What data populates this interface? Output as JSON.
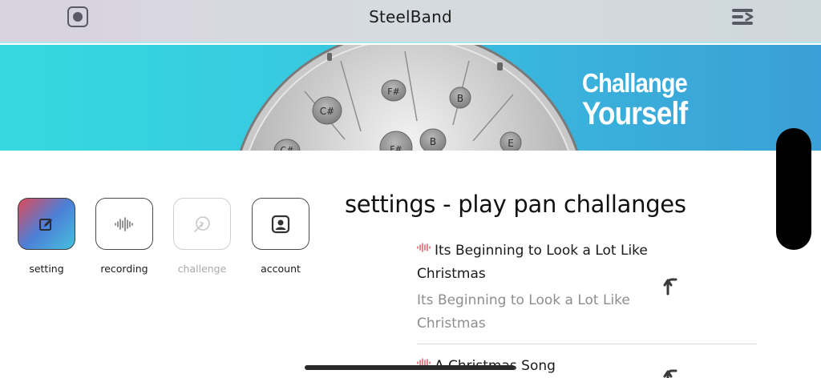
{
  "header": {
    "title": "SteelBand",
    "record_icon": "record-icon",
    "menu_icon": "menu-icon"
  },
  "banner": {
    "headline_line1": "Challange",
    "headline_line2": "Yourself",
    "drum_notes": [
      "F#",
      "C#",
      "B",
      "B",
      "E",
      "F#",
      "C#"
    ]
  },
  "nav": {
    "items": [
      {
        "label": "setting",
        "icon": "edit-icon",
        "state": "active"
      },
      {
        "label": "recording",
        "icon": "waveform-icon",
        "state": "normal"
      },
      {
        "label": "challenge",
        "icon": "target-icon",
        "state": "disabled"
      },
      {
        "label": "account",
        "icon": "person-icon",
        "state": "normal"
      }
    ]
  },
  "main": {
    "title": "settings - play pan challanges",
    "songs": [
      {
        "title": "Its Beginning to Look a Lot Like Christmas",
        "subtitle": "Its Beginning to Look a Lot Like Christmas",
        "icon": "waveform-icon",
        "action_icon": "share-arrow-icon"
      },
      {
        "title": "A Christmas Song",
        "icon": "waveform-icon",
        "action_icon": "share-arrow-icon"
      }
    ]
  },
  "colors": {
    "banner_start": "#36d9df",
    "banner_end": "#3a9fd6",
    "accent_red": "#e65c68",
    "muted_text": "#8e8e8e"
  }
}
